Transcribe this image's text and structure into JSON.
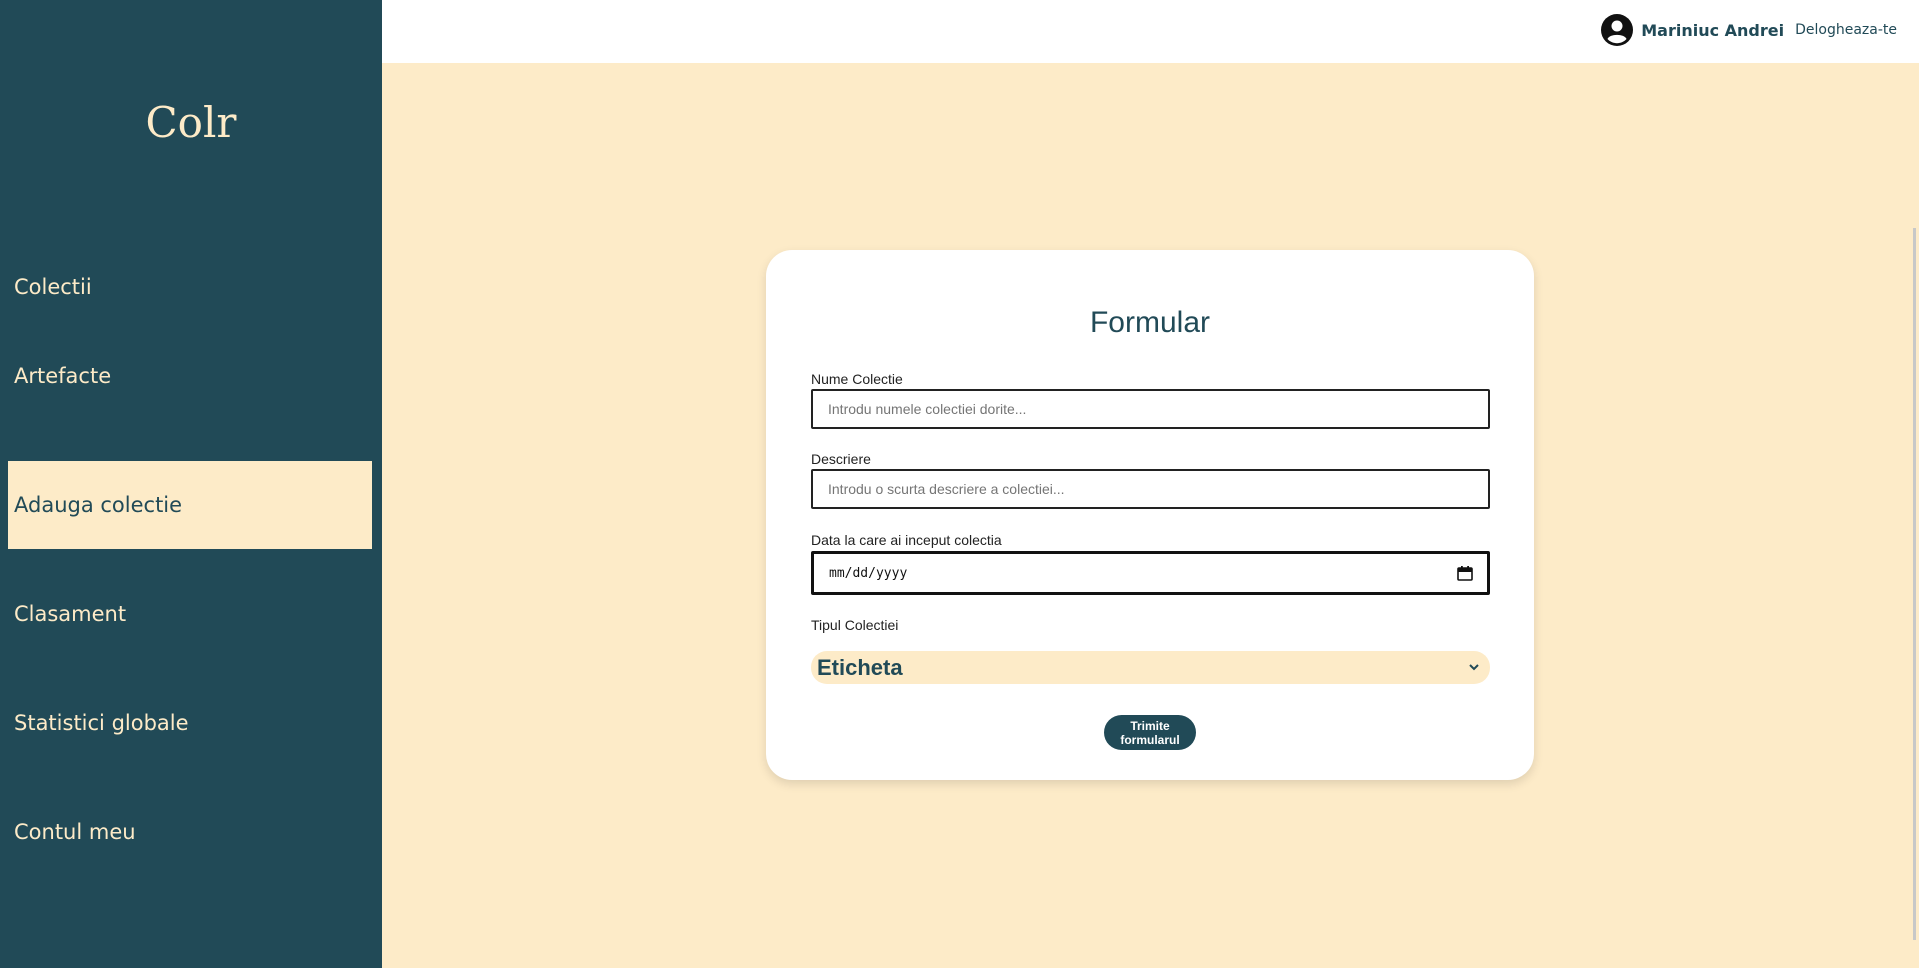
{
  "app": {
    "brand": "Colr"
  },
  "sidebar": {
    "items": [
      {
        "label": "Colectii",
        "active": false
      },
      {
        "label": "Artefacte",
        "active": false
      },
      {
        "label": "Adauga colectie",
        "active": true
      },
      {
        "label": "Clasament",
        "active": false
      },
      {
        "label": "Statistici globale",
        "active": false
      },
      {
        "label": "Contul meu",
        "active": false
      }
    ]
  },
  "header": {
    "user_icon": "account-circle-icon",
    "user_name": "Mariniuc Andrei",
    "logout_label": "Delogheaza-te"
  },
  "form": {
    "title": "Formular",
    "name_label": "Nume Colectie",
    "name_placeholder": "Introdu numele colectiei dorite...",
    "description_label": "Descriere",
    "description_placeholder": "Introdu o scurta descriere a colectiei...",
    "date_label": "Data la care ai inceput colectia",
    "date_value": "mm/dd/yyyy",
    "date_icon": "calendar-icon",
    "type_label": "Tipul Colectiei",
    "type_selected": "Eticheta",
    "type_icon": "chevron-down-icon",
    "submit_label": "Trimite formularul"
  },
  "colors": {
    "primary": "#214a57",
    "background": "#fdebc8",
    "card": "#ffffff"
  }
}
